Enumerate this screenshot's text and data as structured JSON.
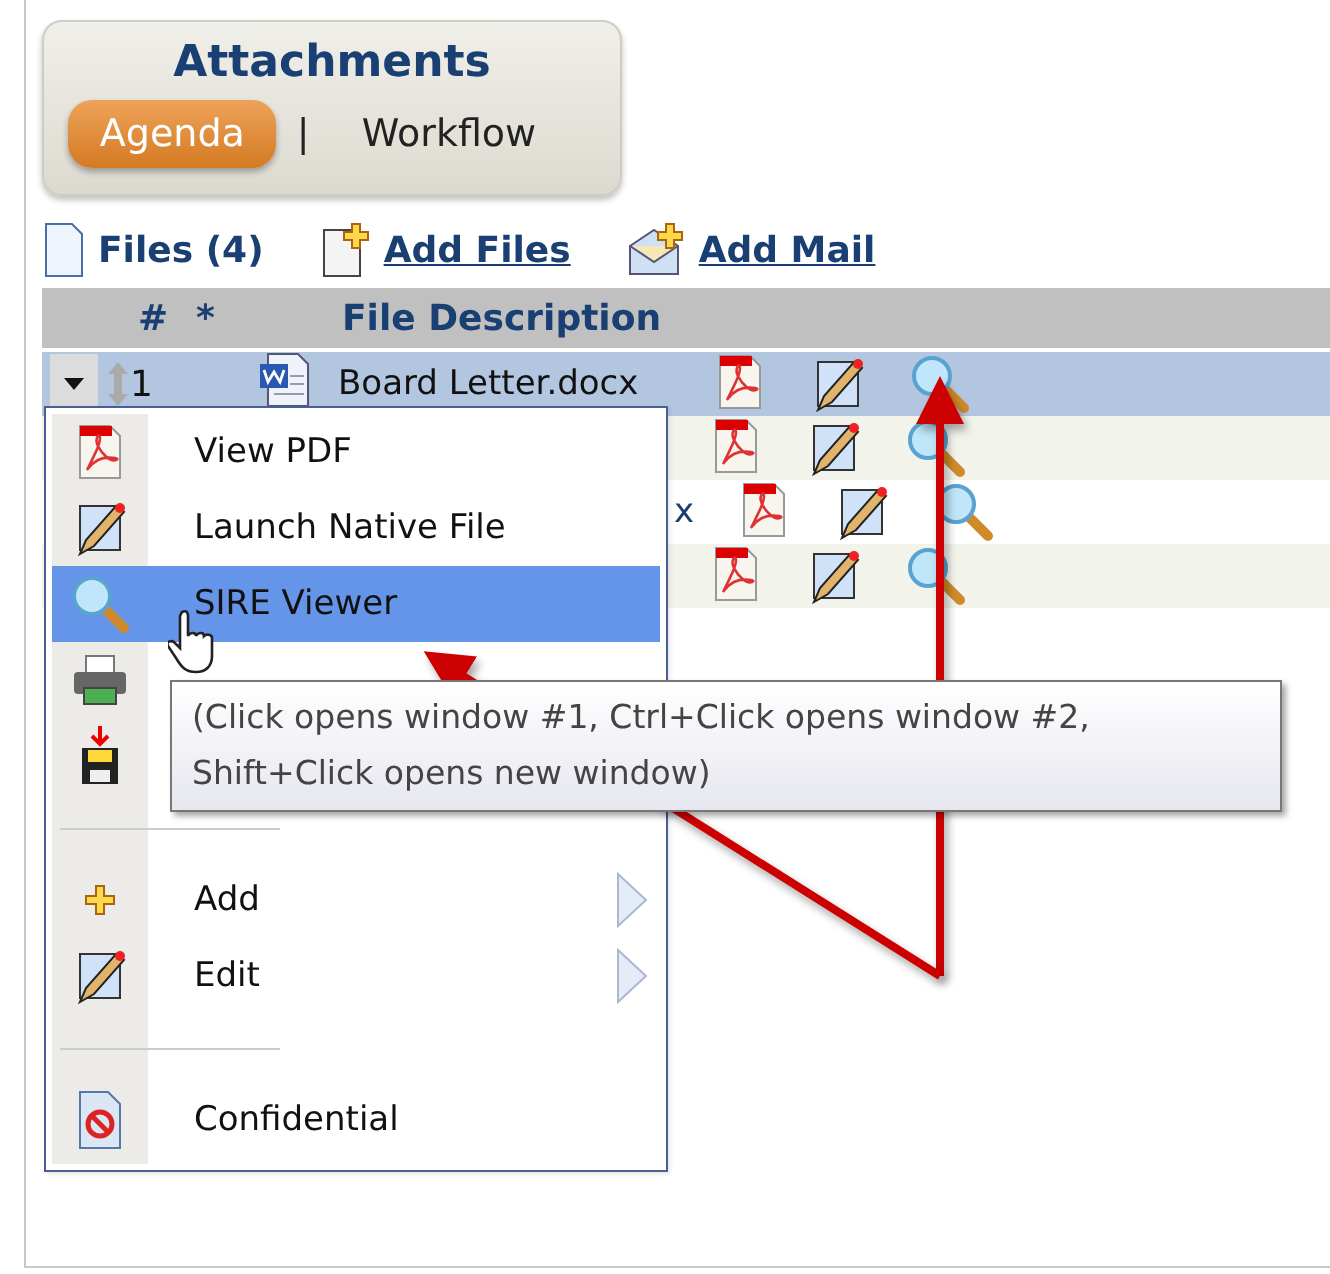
{
  "header": {
    "title": "Attachments",
    "tabs": [
      {
        "label": "Agenda",
        "selected": true
      },
      {
        "label": "Workflow",
        "selected": false
      }
    ],
    "tab_separator": "|"
  },
  "toolbar": {
    "files": "Files (4)",
    "links": [
      {
        "kind": "files",
        "label": "Add Files"
      },
      {
        "kind": "mail",
        "label": "Add Mail"
      }
    ]
  },
  "table": {
    "columns": [
      "#",
      "*",
      "File Description"
    ],
    "rows": [
      {
        "number": "1",
        "description": "Board Letter.docx",
        "selected": true
      },
      {
        "selected": false
      },
      {
        "description_tail": "x",
        "selected": false
      },
      {
        "selected": false
      }
    ]
  },
  "context_menu": {
    "items": [
      {
        "kind": "pdf",
        "label": "View PDF",
        "selected": false
      },
      {
        "kind": "pencil",
        "label": "Launch Native File",
        "selected": false
      },
      {
        "kind": "magnifier",
        "label": "SIRE Viewer",
        "selected": true
      },
      {
        "kind": "printer",
        "selected": false
      },
      {
        "kind": "save",
        "selected": false
      },
      {
        "kind": "separator"
      },
      {
        "kind": "plus",
        "label": "Add",
        "submenu": true,
        "selected": false
      },
      {
        "kind": "pencil",
        "label": "Edit",
        "submenu": true,
        "selected": false
      },
      {
        "kind": "separator"
      },
      {
        "kind": "confidential",
        "label": "Confidential",
        "selected": false
      }
    ]
  },
  "tooltip": "(Click opens window #1, Ctrl+Click opens window #2, Shift+Click opens new window)"
}
